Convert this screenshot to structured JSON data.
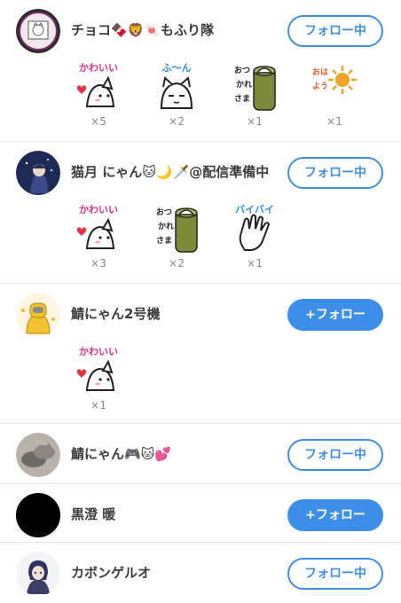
{
  "users": [
    {
      "name": "チョコ🍫🦁🍬もふり隊",
      "button": "フォロー中",
      "avatar_icon": "framed-cat-drawing-avatar",
      "stamps": [
        {
          "icon": "kawaii-cat-stamp",
          "caption": "かわいい",
          "count": "×5"
        },
        {
          "icon": "fuun-cat-stamp",
          "caption": "ふ〜ん",
          "count": "×2"
        },
        {
          "icon": "otsukaresama-cat-stamp",
          "caption": "おつかれさま",
          "count": "×1"
        },
        {
          "icon": "ohayou-sun-stamp",
          "caption": "おはよう",
          "count": "×1"
        }
      ]
    },
    {
      "name": "猫月 にゃん🐱🌙🗡️@配信準備中",
      "button": "フォロー中",
      "avatar_icon": "night-sky-character-avatar",
      "stamps": [
        {
          "icon": "kawaii-cat-stamp",
          "caption": "かわいい",
          "count": "×3"
        },
        {
          "icon": "otsukaresama-cat-stamp",
          "caption": "おつかれさま",
          "count": "×2"
        },
        {
          "icon": "baibai-hand-stamp",
          "caption": "バイバイ",
          "count": "×1"
        }
      ]
    },
    {
      "name": "鯖にゃん2号機",
      "button": "+フォロー",
      "avatar_icon": "yellow-robot-avatar",
      "stamps": [
        {
          "icon": "kawaii-cat-stamp",
          "caption": "かわいい",
          "count": "×1"
        }
      ]
    },
    {
      "name": "鯖にゃん🎮🐱💕",
      "button": "フォロー中",
      "avatar_icon": "sleeping-cats-photo-avatar",
      "stamps": []
    },
    {
      "name": "黒澄 暖",
      "button": "+フォロー",
      "avatar_icon": "black-circle-avatar",
      "stamps": []
    },
    {
      "name": "カボンゲルオ",
      "button": "フォロー中",
      "avatar_icon": "anime-girl-avatar",
      "stamps": []
    }
  ],
  "colors": {
    "accent": "#3d8ee9",
    "kawaii": "#e4308a",
    "heart": "#e8323c"
  }
}
